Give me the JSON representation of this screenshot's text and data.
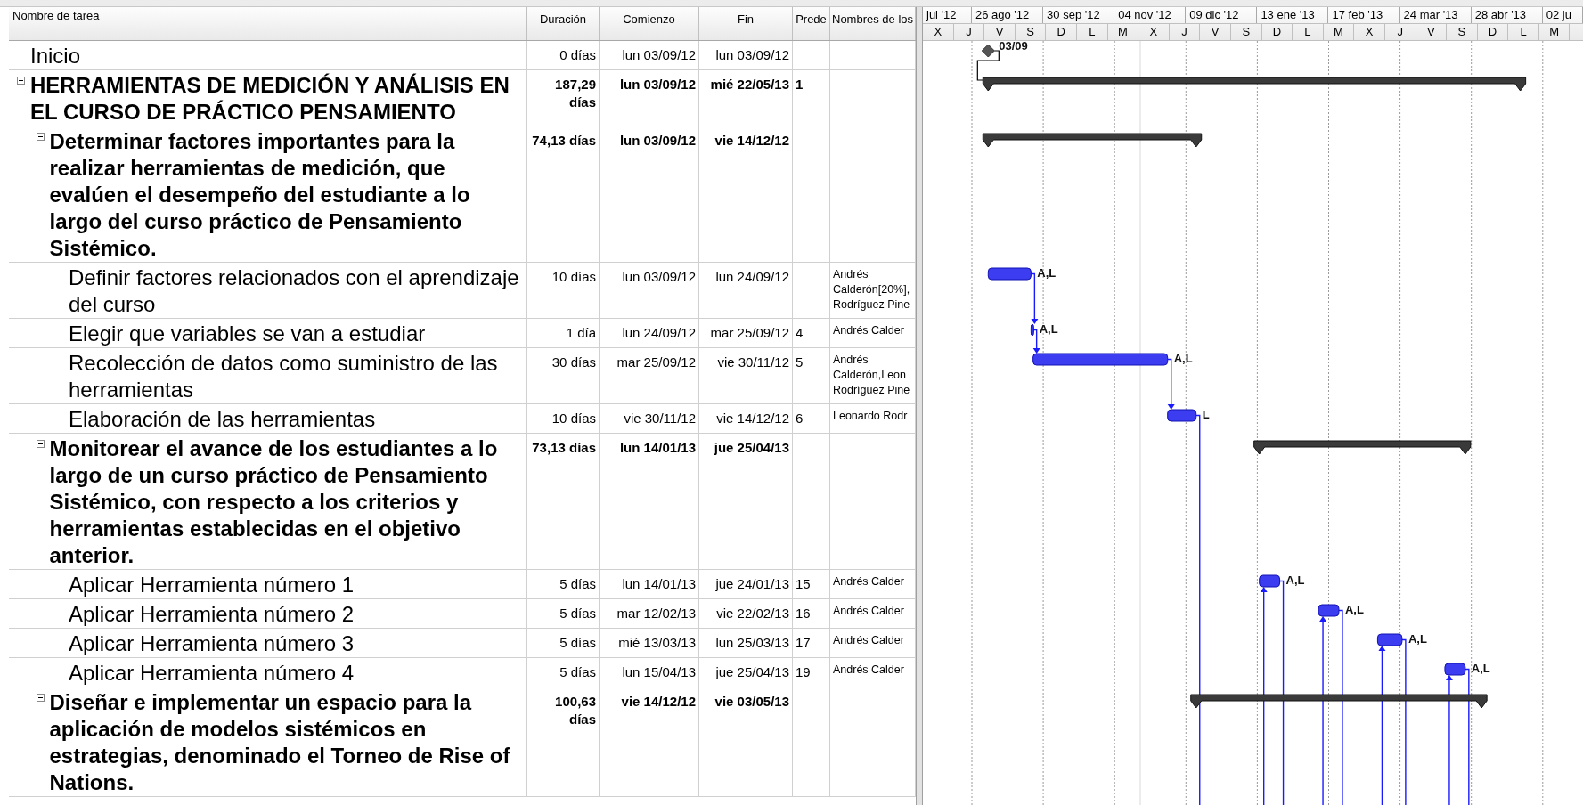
{
  "columns": [
    "Nombre de tarea",
    "Duración",
    "Comienzo",
    "Fin",
    "Prede",
    "Nombres de los"
  ],
  "timescale": {
    "major": [
      "jul '12",
      "26 ago '12",
      "30 sep '12",
      "04 nov '12",
      "09 dic '12",
      "13 ene '13",
      "17 feb '13",
      "24 mar '13",
      "28 abr '13",
      "02 ju"
    ],
    "minor": [
      "X",
      "J",
      "V",
      "S",
      "D",
      "L",
      "M",
      "X",
      "J",
      "V",
      "S",
      "D",
      "L",
      "M",
      "X",
      "J",
      "V",
      "S",
      "D",
      "L",
      "M"
    ]
  },
  "tasks": [
    {
      "name": "Inicio",
      "kind": "milestone",
      "duration": "0 días",
      "start": "lun 03/09/12",
      "finish": "lun 03/09/12",
      "bar_label": "03/09"
    },
    {
      "name": "HERRAMIENTAS DE MEDICIÓN Y ANÁLISIS EN EL CURSO DE PRÁCTICO PENSAMIENTO",
      "kind": "summary",
      "expanded": true,
      "duration": "187,29 días",
      "start": "lun 03/09/12",
      "finish": "mié 22/05/13",
      "predecessors": "1",
      "children": [
        {
          "name": "Determinar factores importantes para la realizar herramientas de medición, que evalúen el desempeño del estudiante a lo largo del curso práctico de Pensamiento Sistémico.",
          "kind": "summary",
          "expanded": true,
          "duration": "74,13 días",
          "start": "lun 03/09/12",
          "finish": "vie 14/12/12",
          "children": [
            {
              "name": "Definir factores relacionados con el aprendizaje del curso",
              "kind": "task",
              "duration": "10 días",
              "start": "lun 03/09/12",
              "finish": "lun 24/09/12",
              "resources": "Andrés\nCalderón[20%],\nRodríguez Pine",
              "bar_label": "A,L"
            },
            {
              "name": "Elegir que variables se van a estudiar",
              "kind": "task",
              "duration": "1 día",
              "start": "lun 24/09/12",
              "finish": "mar 25/09/12",
              "predecessors": "4",
              "resources": "Andrés Calder",
              "bar_label": "A,L"
            },
            {
              "name": "Recolección de datos como suministro de las herramientas",
              "kind": "task",
              "duration": "30 días",
              "start": "mar 25/09/12",
              "finish": "vie 30/11/12",
              "predecessors": "5",
              "resources": "Andrés\nCalderón,Leon\nRodríguez Pine",
              "bar_label": "A,L"
            },
            {
              "name": "Elaboración de las herramientas",
              "kind": "task",
              "duration": "10 días",
              "start": "vie 30/11/12",
              "finish": "vie 14/12/12",
              "predecessors": "6",
              "resources": "Leonardo Rodr",
              "bar_label": "L",
              "link_down": true
            }
          ]
        },
        {
          "name": "Monitorear el avance de los estudiantes a lo largo de un curso práctico de Pensamiento Sistémico, con respecto a los criterios y herramientas establecidas en el objetivo anterior.",
          "kind": "summary",
          "expanded": true,
          "duration": "73,13 días",
          "start": "lun 14/01/13",
          "finish": "jue 25/04/13",
          "children": [
            {
              "name": "Aplicar Herramienta número 1",
              "kind": "task",
              "duration": "5 días",
              "start": "lun 14/01/13",
              "finish": "jue 24/01/13",
              "predecessors": "15",
              "resources": "Andrés Calder",
              "bar_label": "A,L",
              "link_down": true
            },
            {
              "name": "Aplicar Herramienta número 2",
              "kind": "task",
              "duration": "5 días",
              "start": "mar 12/02/13",
              "finish": "vie 22/02/13",
              "predecessors": "16",
              "resources": "Andrés Calder",
              "bar_label": "A,L",
              "link_down": true
            },
            {
              "name": "Aplicar Herramienta número 3",
              "kind": "task",
              "duration": "5 días",
              "start": "mié 13/03/13",
              "finish": "lun 25/03/13",
              "predecessors": "17",
              "resources": "Andrés Calder",
              "bar_label": "A,L",
              "link_down": true
            },
            {
              "name": "Aplicar Herramienta número 4",
              "kind": "task",
              "duration": "5 días",
              "start": "lun 15/04/13",
              "finish": "jue 25/04/13",
              "predecessors": "19",
              "resources": "Andrés Calder",
              "bar_label": "A,L",
              "link_down": true
            }
          ]
        },
        {
          "name": "Diseñar e implementar un espacio para la aplicación de modelos sistémicos en estrategias, denominado el Torneo de Rise of Nations.",
          "kind": "summary",
          "expanded": true,
          "duration": "100,63 días",
          "start": "vie 14/12/12",
          "finish": "vie 03/05/13"
        }
      ]
    }
  ]
}
